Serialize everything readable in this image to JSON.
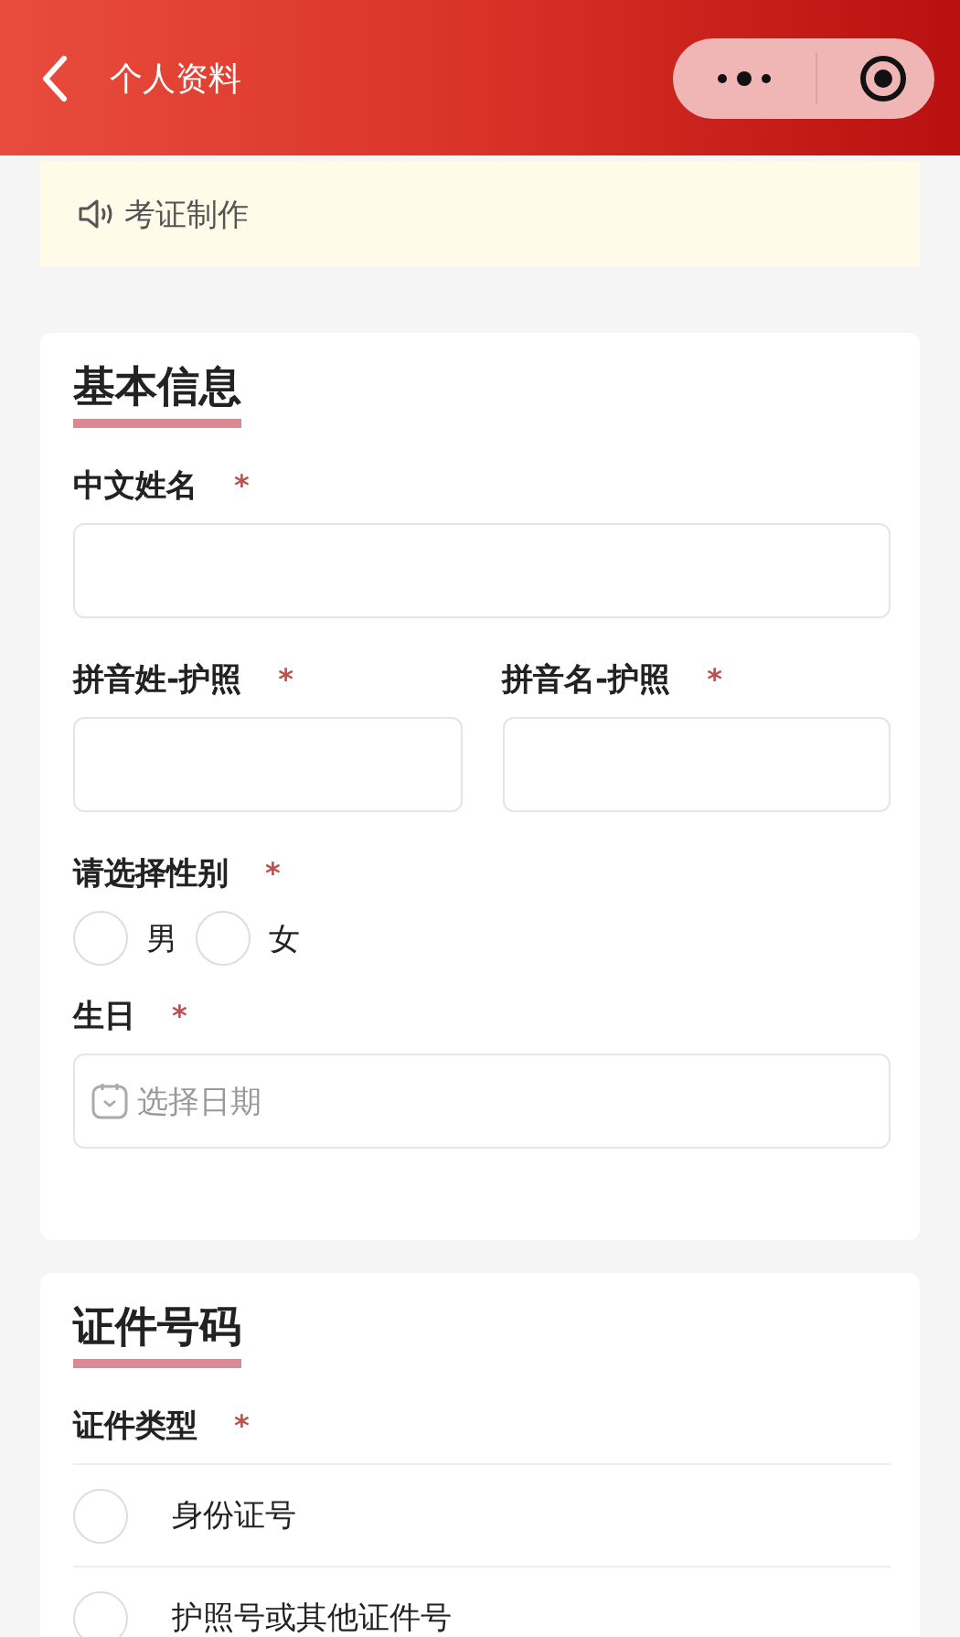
{
  "header": {
    "title": "个人资料"
  },
  "notice": {
    "text": "考证制作"
  },
  "sections": [
    {
      "title": "基本信息",
      "fields": [
        {
          "kind": "text",
          "label": "中文姓名",
          "mark": "*"
        },
        {
          "kind": "pair",
          "items": [
            {
              "label": "拼音姓-护照",
              "mark": "*"
            },
            {
              "label": "拼音名-护照",
              "mark": "*"
            }
          ]
        },
        {
          "kind": "radio-inline",
          "label": "请选择性别",
          "mark": "*",
          "options": [
            {
              "label": "男",
              "selected": false
            },
            {
              "label": "女",
              "selected": false
            }
          ]
        },
        {
          "kind": "date",
          "label": "生日",
          "mark": "*",
          "placeholder": "选择日期"
        }
      ]
    },
    {
      "title": "证件号码",
      "fields": [
        {
          "kind": "radio-list",
          "label": "证件类型",
          "mark": "*",
          "options": [
            {
              "label": "身份证号",
              "selected": false
            },
            {
              "label": "护照号或其他证件号",
              "selected": false
            }
          ]
        }
      ]
    }
  ]
}
